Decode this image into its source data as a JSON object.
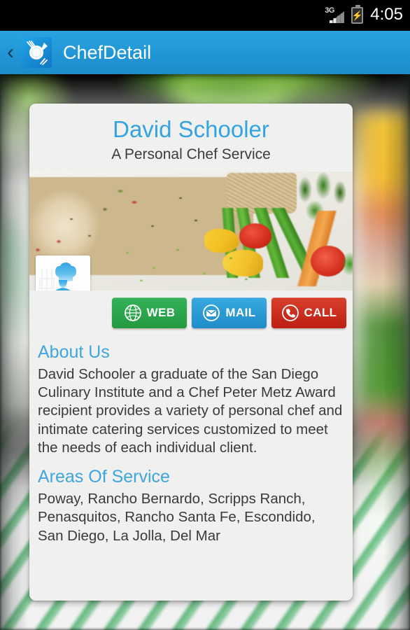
{
  "status_bar": {
    "network_label": "3G",
    "network_icon": "signal-bars-icon",
    "battery_icon": "battery-charging-icon",
    "time": "4:05"
  },
  "action_bar": {
    "back_icon": "back-chevron-icon",
    "app_icon": "plate-fork-knife-icon",
    "title": "ChefDetail",
    "background_color": "#2196d6"
  },
  "background": {
    "description": "blurred food photograph with green and white striped napkin"
  },
  "card": {
    "chef_name": "David Schooler",
    "tagline": "A Personal Chef Service",
    "name_color": "#35a3e0",
    "hero_image": {
      "name": "food-photo",
      "description": "sliced herb chicken breast with green beans, carrots, tomatoes, broccolini, yellow squash and rice"
    },
    "avatar": {
      "name": "chef-avatar-placeholder",
      "icon": "chef-silhouette-icon",
      "color": "#3aa8e0"
    },
    "actions": [
      {
        "label": "WEB",
        "icon": "globe-icon",
        "color": "#23983f"
      },
      {
        "label": "MAIL",
        "icon": "envelope-icon",
        "color": "#1f8cc8"
      },
      {
        "label": "CALL",
        "icon": "phone-icon",
        "color": "#bd1e12"
      }
    ],
    "sections": [
      {
        "title": "About Us",
        "body": "David Schooler a graduate of the San Diego Culinary Institute and a Chef Peter Metz Award recipient provides a variety of personal chef and intimate catering services customized to meet the needs of each individual client."
      },
      {
        "title": "Areas Of Service",
        "body": "Poway, Rancho Bernardo, Scripps Ranch, Penasquitos, Rancho Santa Fe, Escondido, San Diego, La Jolla, Del Mar"
      }
    ]
  }
}
